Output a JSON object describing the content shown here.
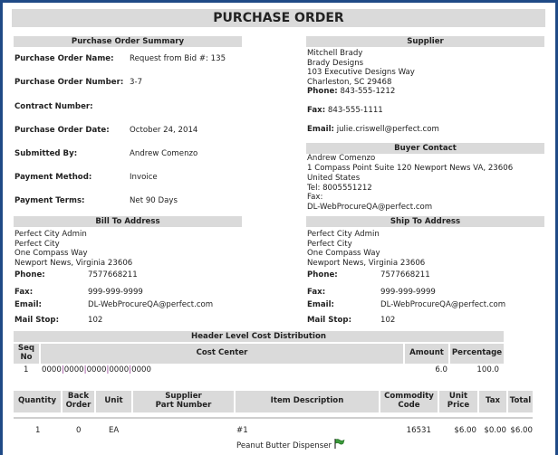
{
  "title": "PURCHASE ORDER",
  "summary": {
    "header": "Purchase Order Summary",
    "rows": [
      {
        "label": "Purchase Order Name:",
        "value": "Request from Bid #: 135"
      },
      {
        "label": "Purchase Order Number:",
        "value": "3-7"
      },
      {
        "label": "Contract Number:",
        "value": ""
      },
      {
        "label": "Purchase Order Date:",
        "value": "October 24, 2014"
      },
      {
        "label": "Submitted By:",
        "value": "Andrew Comenzo"
      },
      {
        "label": "Payment Method:",
        "value": "Invoice"
      },
      {
        "label": "Payment Terms:",
        "value": "Net 90 Days"
      }
    ]
  },
  "supplier": {
    "header": "Supplier",
    "lines": [
      "Mitchell Brady",
      "Brady Designs",
      "103 Executive Designs Way",
      "Charleston, SC 29468"
    ],
    "phone_label": "Phone:",
    "phone": "843-555-1212",
    "fax_label": "Fax:",
    "fax": "843-555-1111",
    "email_label": "Email:",
    "email": "julie.criswell@perfect.com"
  },
  "buyer": {
    "header": "Buyer Contact",
    "lines": [
      "Andrew Comenzo",
      "1 Compass Point Suite 120 Newport News VA, 23606",
      "United States",
      "Tel: 8005551212",
      "Fax:",
      "DL-WebProcureQA@perfect.com"
    ]
  },
  "bill_to": {
    "header": "Bill To Address",
    "lines": [
      "Perfect City Admin",
      "Perfect City",
      "One Compass Way",
      "Newport News, Virginia 23606"
    ],
    "phone_label": "Phone:",
    "phone": "7577668211",
    "fax_label": "Fax:",
    "fax": "999-999-9999",
    "email_label": "Email:",
    "email": "DL-WebProcureQA@perfect.com",
    "mail_label": "Mail Stop:",
    "mail": "102"
  },
  "ship_to": {
    "header": "Ship To Address",
    "lines": [
      "Perfect City Admin",
      "Perfect City",
      "One Compass Way",
      "Newport News, Virginia 23606"
    ],
    "phone_label": "Phone:",
    "phone": "7577668211",
    "fax_label": "Fax:",
    "fax": "999-999-9999",
    "email_label": "Email:",
    "email": "DL-WebProcureQA@perfect.com",
    "mail_label": "Mail Stop:",
    "mail": "102"
  },
  "cost": {
    "header": "Header Level Cost Distribution",
    "cols": [
      "Seq\nNo",
      "Cost Center",
      "Amount",
      "Percentage"
    ],
    "row": {
      "seq": "1",
      "segments": [
        "0000",
        "0000",
        "0000",
        "0000",
        "0000"
      ],
      "sep": "|",
      "amount": "6.0",
      "percentage": "100.0"
    }
  },
  "items": {
    "cols": [
      "Quantity",
      "Back\nOrder",
      "Unit",
      "Supplier\nPart Number",
      "Item Description",
      "Commodity\nCode",
      "Unit\nPrice",
      "Tax",
      "Total"
    ],
    "row": {
      "quantity": "1",
      "back_order": "0",
      "unit": "EA",
      "part": "",
      "desc_num": "#1",
      "desc": "Peanut Butter Dispenser",
      "commodity": "16531",
      "unit_price": "$6.00",
      "tax": "$0.00",
      "total": "$6.00"
    }
  },
  "colors": {
    "frame": "#1f4a86",
    "header_bg": "#dadada",
    "flag": "#3a9a3a"
  }
}
